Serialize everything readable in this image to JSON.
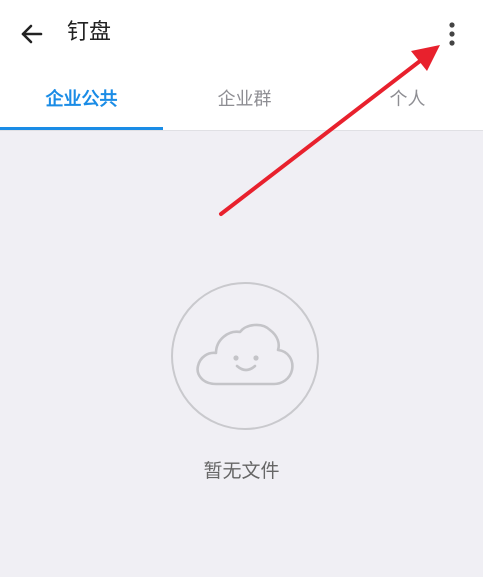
{
  "header": {
    "title": "钉盘",
    "back_icon": "arrow-left-icon",
    "more_icon": "more-vertical-icon"
  },
  "tabs": [
    {
      "label": "企业公共",
      "active": true
    },
    {
      "label": "企业群",
      "active": false
    },
    {
      "label": "个人",
      "active": false
    }
  ],
  "empty_state": {
    "icon": "smiling-cloud-icon",
    "text": "暂无文件"
  },
  "annotation": {
    "type": "arrow",
    "color": "#e8212d",
    "points_to": "more-button"
  },
  "colors": {
    "accent": "#1a8ce6",
    "background": "#f0eff4",
    "header_bg": "#ffffff"
  }
}
